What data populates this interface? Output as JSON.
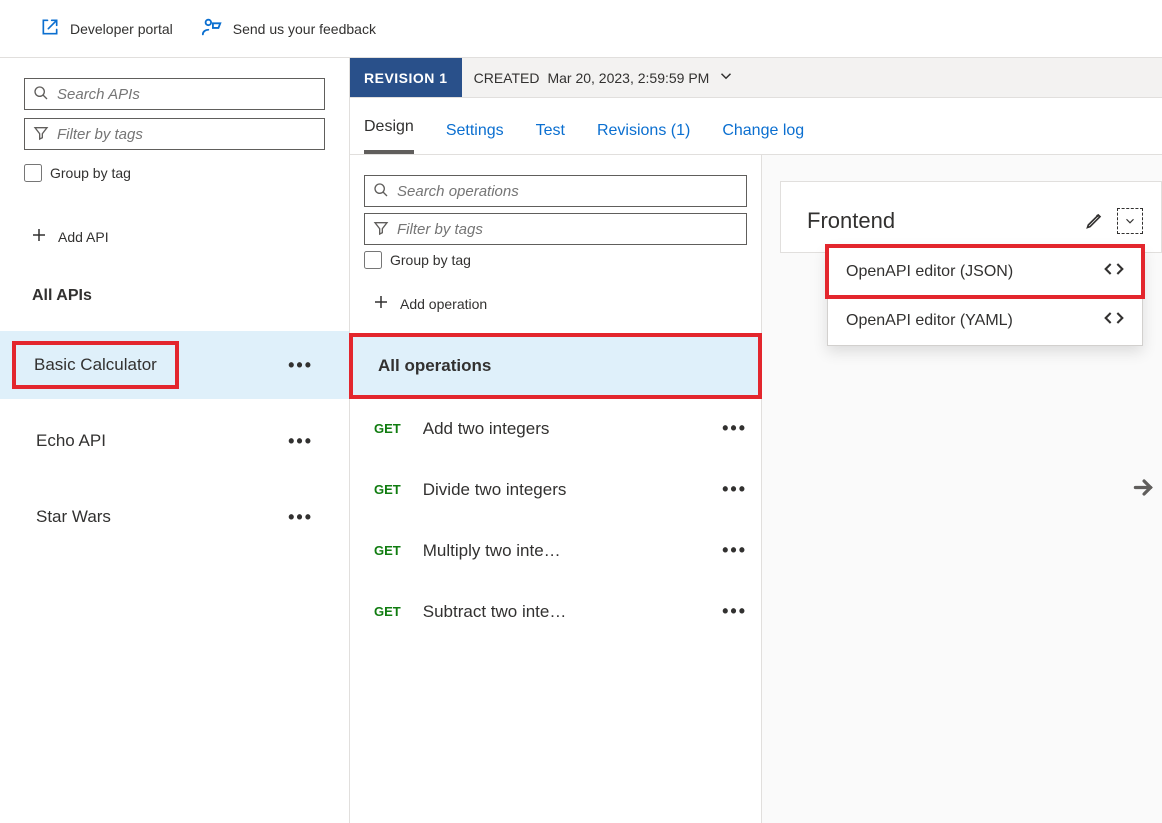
{
  "topbar": {
    "dev_portal": "Developer portal",
    "feedback": "Send us your feedback"
  },
  "left": {
    "search_placeholder": "Search APIs",
    "filter_placeholder": "Filter by tags",
    "group_by_tag": "Group by tag",
    "add_api": "Add API",
    "all_apis": "All APIs",
    "apis": [
      {
        "name": "Basic Calculator",
        "selected": true,
        "highlight": true
      },
      {
        "name": "Echo API",
        "selected": false,
        "highlight": false
      },
      {
        "name": "Star Wars",
        "selected": false,
        "highlight": false
      }
    ]
  },
  "revision": {
    "badge": "REVISION 1",
    "created_label": "CREATED",
    "created_at": "Mar 20, 2023, 2:59:59 PM"
  },
  "tabs": {
    "design": "Design",
    "settings": "Settings",
    "test": "Test",
    "revisions": "Revisions (1)",
    "changelog": "Change log"
  },
  "ops_panel": {
    "search_placeholder": "Search operations",
    "filter_placeholder": "Filter by tags",
    "group_by_tag": "Group by tag",
    "add_operation": "Add operation",
    "all_operations": "All operations",
    "operations": [
      {
        "method": "GET",
        "name": "Add two integers"
      },
      {
        "method": "GET",
        "name": "Divide two integers"
      },
      {
        "method": "GET",
        "name": "Multiply two integers"
      },
      {
        "method": "GET",
        "name": "Subtract two integers"
      }
    ]
  },
  "frontend": {
    "title": "Frontend",
    "dropdown": [
      {
        "label": "OpenAPI editor (JSON)",
        "highlight": true
      },
      {
        "label": "OpenAPI editor (YAML)",
        "highlight": false
      }
    ]
  }
}
